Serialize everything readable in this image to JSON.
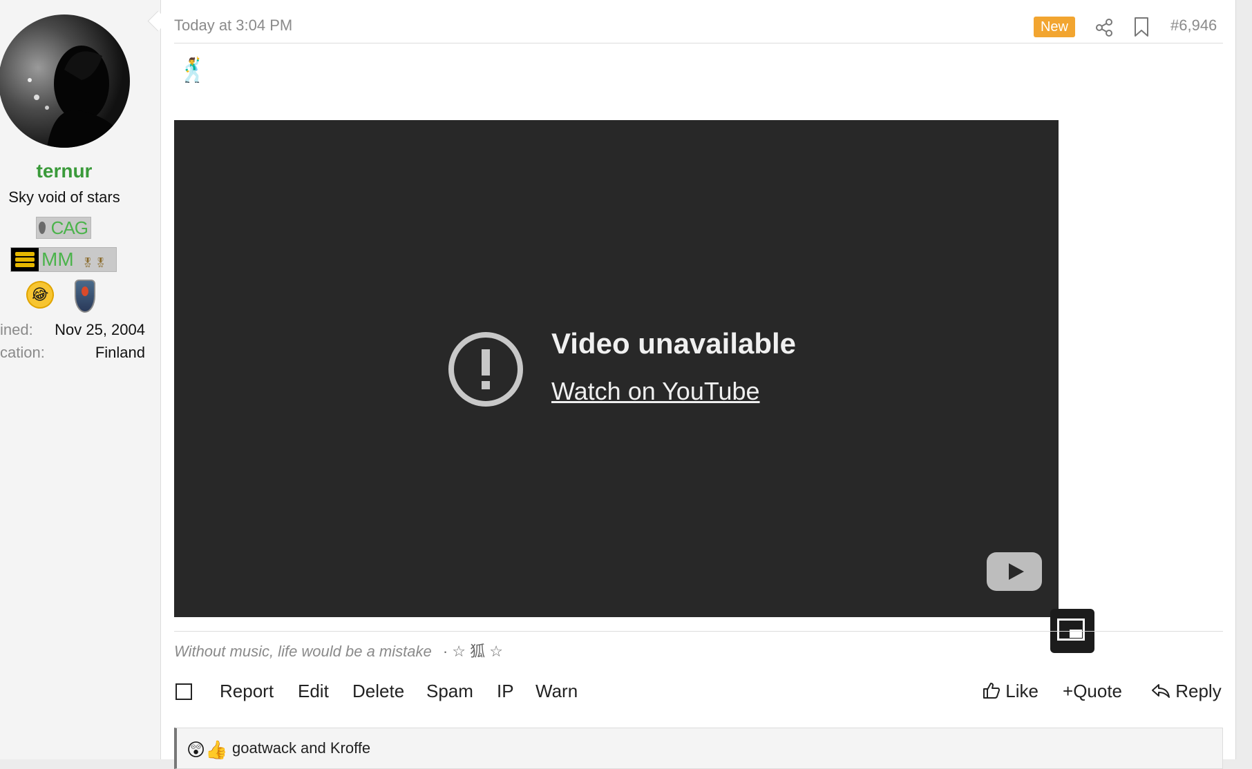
{
  "user": {
    "name": "ternur",
    "title": "Sky void of stars",
    "banner_cag": "CAG",
    "banner_mm": "MM",
    "joined_label": "ined:",
    "joined_value": "Nov 25, 2004",
    "location_label": "cation:",
    "location_value": "Finland"
  },
  "post": {
    "time": "Today at 3:04 PM",
    "new_badge": "New",
    "number": "#6,946",
    "emoji": "🕺"
  },
  "video": {
    "title": "Video unavailable",
    "link": "Watch on YouTube"
  },
  "signature": {
    "text": "Without music, life would be a mistake",
    "extra": "· ☆ 狐 ☆"
  },
  "actions": {
    "report": "Report",
    "edit": "Edit",
    "delete": "Delete",
    "spam": "Spam",
    "ip": "IP",
    "warn": "Warn",
    "like": "Like",
    "quote": "Quote",
    "reply": "Reply"
  },
  "reactions": {
    "emojis": "😲👍",
    "text": "goatwack and Kroffe"
  },
  "colors": {
    "username": "#3a9a3a",
    "new_badge": "#f2a530",
    "video_bg": "#282828"
  }
}
